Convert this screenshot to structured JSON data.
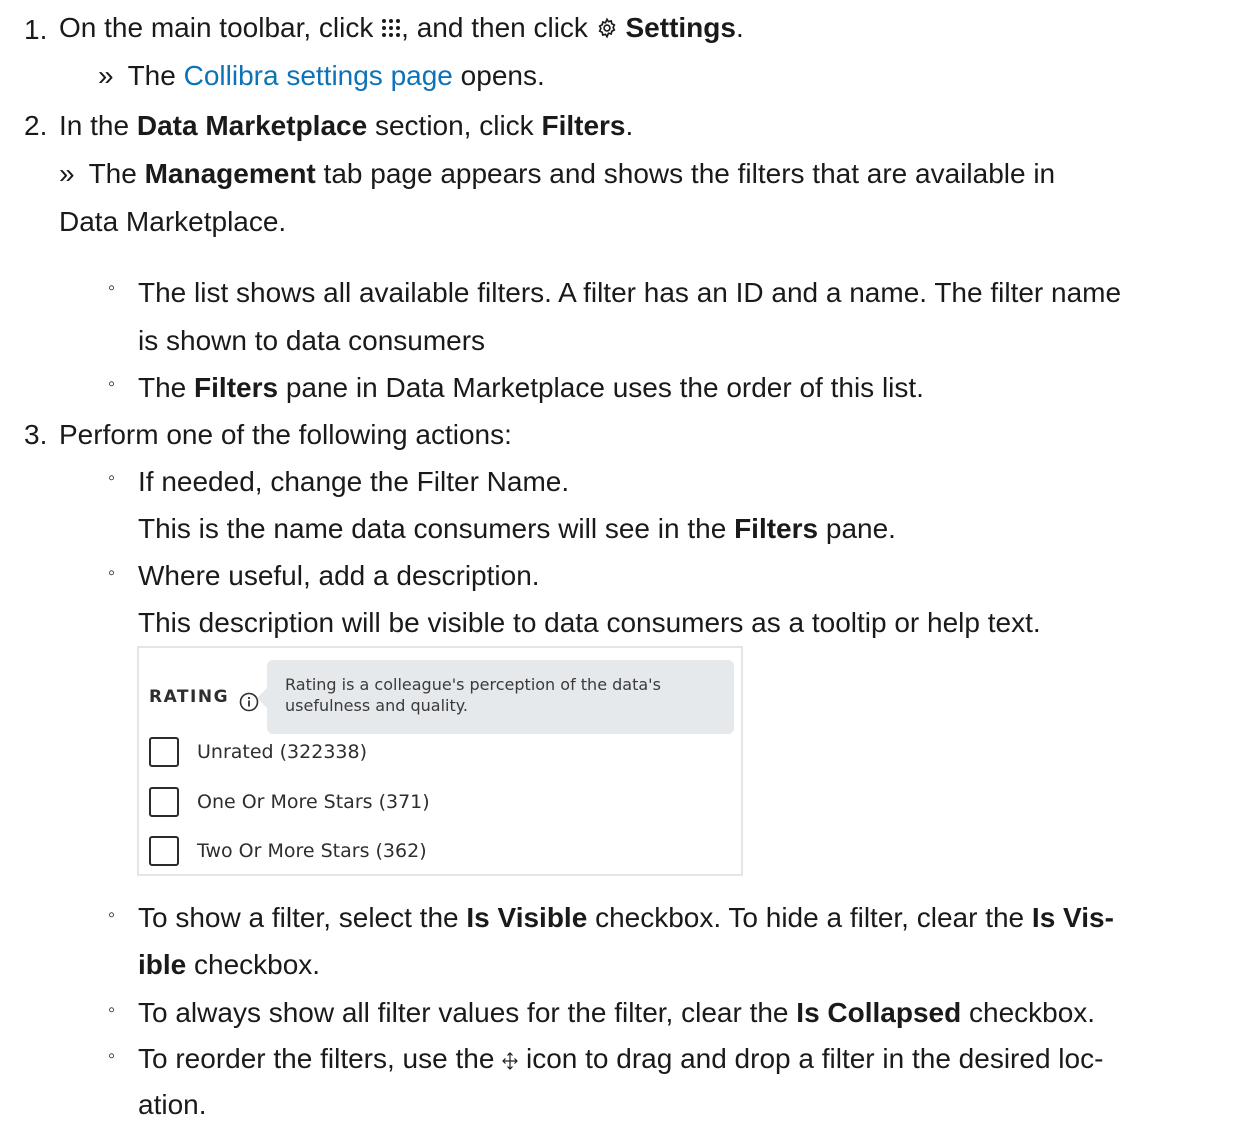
{
  "steps": {
    "s1": {
      "num": "1.",
      "pre": "On the main toolbar, click",
      "mid": ", and then click",
      "settings": "Settings",
      "post": ".",
      "result_pre": "The",
      "result_link": "Collibra settings page",
      "result_post": "opens."
    },
    "s2": {
      "num": "2.",
      "pre": "In the",
      "section": "Data Marketplace",
      "mid": "section, click",
      "filters": "Filters",
      "post": ".",
      "result_pre": "The",
      "tab": "Management",
      "result_post": "tab page appears and shows the filters that are available in",
      "result_line2": "Data Marketplace.",
      "b1_line1": "The list shows all available filters. A filter has an ID and a name. The filter name",
      "b1_line2": "is shown to data consumers",
      "b2_pre": "The",
      "b2_bold": "Filters",
      "b2_post": "pane in Data Marketplace uses the order of this list."
    },
    "s3": {
      "num": "3.",
      "intro": "Perform one of the following actions:",
      "a1_line1": "If needed, change the Filter Name.",
      "a1_line2_pre": "This is the name data consumers will see in the",
      "a1_line2_bold": "Filters",
      "a1_line2_post": "pane.",
      "a2_line1": "Where useful, add a description.",
      "a2_line2": "This description will be visible to data consumers as a tooltip or help text.",
      "a3_pre": "To show a filter, select the",
      "a3_bold1": "Is Visible",
      "a3_mid": "checkbox. To hide a filter, clear the",
      "a3_bold2": "Is Vis-",
      "a3_line2_bold": "ible",
      "a3_line2_post": "checkbox.",
      "a4_pre": "To always show all filter values for the filter, clear the",
      "a4_bold": "Is Collapsed",
      "a4_post": "checkbox.",
      "a5_pre": "To reorder the filters, use the",
      "a5_post": "icon to drag and drop a filter in the desired loc-",
      "a5_line2": "ation."
    }
  },
  "figure": {
    "heading": "RATING",
    "tooltip": "Rating is a colleague's perception of the data's usefulness and quality.",
    "options": [
      {
        "label": "Unrated (322338)",
        "checked": false
      },
      {
        "label": "One Or More Stars (371)",
        "checked": false
      },
      {
        "label": "Two Or More Stars (362)",
        "checked": false
      }
    ]
  },
  "icons": {
    "apps": "grid-dots-icon",
    "settings": "gear-icon",
    "info": "info-circle-icon",
    "move": "move-arrows-icon"
  },
  "colors": {
    "link": "#0d73b8",
    "tooltip_bg": "#e6e9ec"
  }
}
